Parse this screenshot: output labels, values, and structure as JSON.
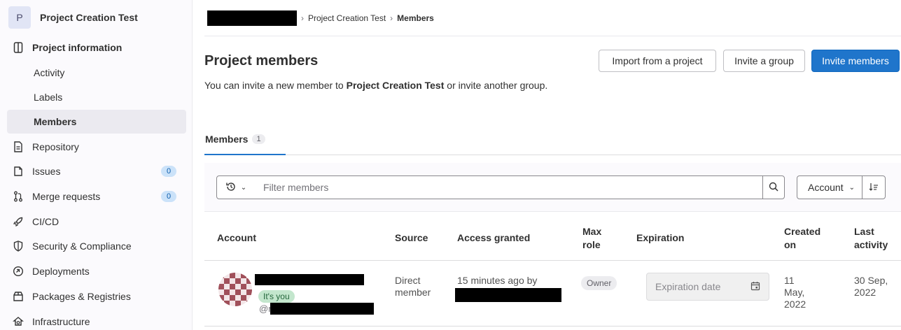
{
  "sidebar": {
    "project_initial": "P",
    "project_name": "Project Creation Test",
    "items": [
      {
        "label": "Project information",
        "icon": "info-icon"
      },
      {
        "label": "Activity"
      },
      {
        "label": "Labels"
      },
      {
        "label": "Members"
      },
      {
        "label": "Repository",
        "icon": "file-icon"
      },
      {
        "label": "Issues",
        "icon": "issues-icon",
        "count": "0"
      },
      {
        "label": "Merge requests",
        "icon": "merge-request-icon",
        "count": "0"
      },
      {
        "label": "CI/CD",
        "icon": "rocket-icon"
      },
      {
        "label": "Security & Compliance",
        "icon": "shield-icon"
      },
      {
        "label": "Deployments",
        "icon": "deployments-icon"
      },
      {
        "label": "Packages & Registries",
        "icon": "package-icon"
      },
      {
        "label": "Infrastructure",
        "icon": "cloud-icon"
      }
    ]
  },
  "breadcrumb": {
    "project": "Project Creation Test",
    "current": "Members"
  },
  "page": {
    "title": "Project members",
    "desc_prefix": "You can invite a new member to ",
    "desc_project": "Project Creation Test",
    "desc_suffix": " or invite another group."
  },
  "buttons": {
    "import": "Import from a project",
    "invite_group": "Invite a group",
    "invite_members": "Invite members"
  },
  "tabs": [
    {
      "label": "Members",
      "count": "1"
    }
  ],
  "filter": {
    "placeholder": "Filter members",
    "sort_label": "Account"
  },
  "table": {
    "headers": {
      "account": "Account",
      "source": "Source",
      "access": "Access granted",
      "max_role_1": "Max",
      "max_role_2": "role",
      "expiration": "Expiration",
      "created_1": "Created",
      "created_2": "on",
      "last_1": "Last",
      "last_2": "activity"
    },
    "row": {
      "you_badge": "It's you",
      "username_prefix": "@r",
      "source_1": "Direct",
      "source_2": "member",
      "access": "15 minutes ago by",
      "role": "Owner",
      "expiration_placeholder": "Expiration date",
      "created_1": "11",
      "created_2": "May,",
      "created_3": "2022",
      "last_1": "30 Sep,",
      "last_2": "2022"
    }
  },
  "colors": {
    "primary": "#1f75cb",
    "badge_green": "#c3e6cd",
    "avatar": "#a0505a"
  }
}
